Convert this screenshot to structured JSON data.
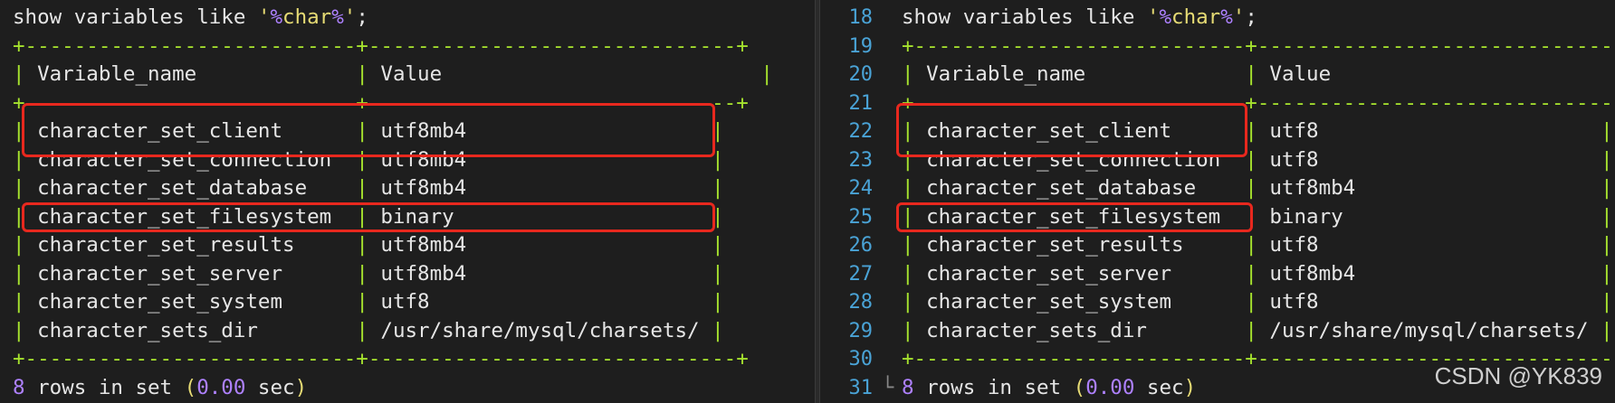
{
  "query": {
    "prefix": "show variables like ",
    "quote_open": "'",
    "pattern_pct1": "%",
    "pattern_word": "char",
    "pattern_pct2": "%",
    "quote_close": "'",
    "terminator": ";"
  },
  "table": {
    "border_line": "+---------------------------+------------------------------+",
    "header": {
      "name": "Variable_name",
      "value": "Value"
    }
  },
  "left": {
    "rows": [
      {
        "name": "character_set_client",
        "value": "utf8mb4"
      },
      {
        "name": "character_set_connection",
        "value": "utf8mb4"
      },
      {
        "name": "character_set_database",
        "value": "utf8mb4"
      },
      {
        "name": "character_set_filesystem",
        "value": "binary"
      },
      {
        "name": "character_set_results",
        "value": "utf8mb4"
      },
      {
        "name": "character_set_server",
        "value": "utf8mb4"
      },
      {
        "name": "character_set_system",
        "value": "utf8"
      },
      {
        "name": "character_sets_dir",
        "value": "/usr/share/mysql/charsets/"
      }
    ]
  },
  "right": {
    "line_numbers": [
      "18",
      "19",
      "20",
      "21",
      "22",
      "23",
      "24",
      "25",
      "26",
      "27",
      "28",
      "29",
      "30",
      "31"
    ],
    "rows": [
      {
        "name": "character_set_client",
        "value": "utf8"
      },
      {
        "name": "character_set_connection",
        "value": "utf8"
      },
      {
        "name": "character_set_database",
        "value": "utf8mb4"
      },
      {
        "name": "character_set_filesystem",
        "value": "binary"
      },
      {
        "name": "character_set_results",
        "value": "utf8"
      },
      {
        "name": "character_set_server",
        "value": "utf8mb4"
      },
      {
        "name": "character_set_system",
        "value": "utf8"
      },
      {
        "name": "character_sets_dir",
        "value": "/usr/share/mysql/charsets/"
      }
    ]
  },
  "footer": {
    "count": "8",
    "rows_text": " rows in set ",
    "paren_open": "(",
    "time": "0.00",
    "unit": " sec",
    "paren_close": ")"
  },
  "watermark": "CSDN @YK839",
  "colors": {
    "background": "#1e1e1e",
    "border_green": "#a6e22e",
    "highlight_red": "#e8281e",
    "line_number_blue": "#4aa3d6",
    "number_purple": "#ae81ff",
    "string_yellow": "#e6db74"
  }
}
